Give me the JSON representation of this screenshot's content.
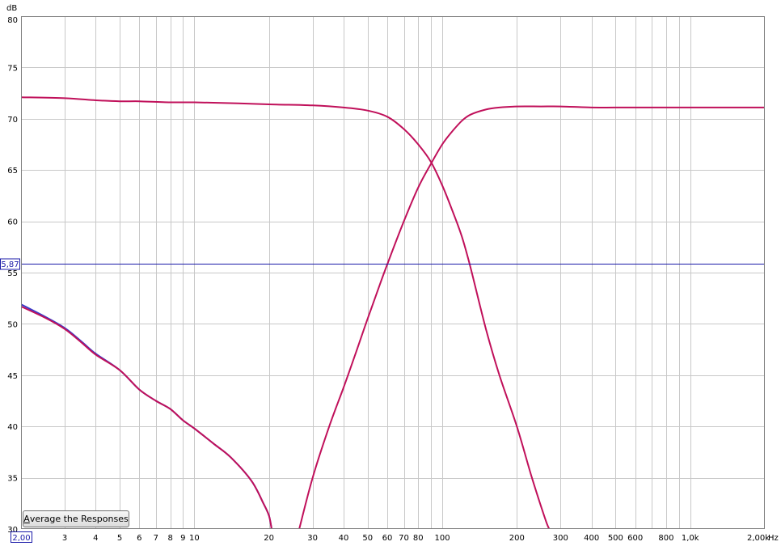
{
  "chart_data": {
    "type": "line",
    "title": "",
    "xlabel": "Hz",
    "ylabel": "dB",
    "xscale": "log",
    "xlim": [
      2,
      2000
    ],
    "ylim": [
      30,
      80
    ],
    "grid": true,
    "x_tick_labels": [
      "2,00",
      "3",
      "4",
      "5",
      "6",
      "7",
      "8",
      "9",
      "10",
      "20",
      "30",
      "40",
      "50",
      "60",
      "70",
      "80",
      "100",
      "200",
      "300",
      "400",
      "500",
      "600",
      "800",
      "1,0k",
      "2,00k"
    ],
    "x_tick_values": [
      2,
      3,
      4,
      5,
      6,
      7,
      8,
      9,
      10,
      20,
      30,
      40,
      50,
      60,
      70,
      80,
      100,
      200,
      300,
      400,
      500,
      600,
      800,
      1000,
      2000
    ],
    "x_unit": "Hz",
    "x_start_label": "2,00",
    "y_tick_labels": [
      "80",
      "75",
      "70",
      "65",
      "60",
      "55",
      "50",
      "45",
      "40",
      "35",
      "30"
    ],
    "y_tick_values": [
      80,
      75,
      70,
      65,
      60,
      55,
      50,
      45,
      40,
      35,
      30
    ],
    "y_unit": "dB",
    "cursor": {
      "value": 55.87,
      "label": "5,87",
      "color": "#1a1aa8"
    },
    "series": [
      {
        "color": "#c0105a",
        "x": [
          2,
          3,
          4,
          5,
          6,
          8,
          10,
          15,
          20,
          30,
          40,
          50,
          60,
          70,
          80,
          90,
          100,
          110,
          120,
          130,
          150,
          170,
          200,
          230,
          260,
          270
        ],
        "y": [
          72.1,
          72.0,
          71.8,
          71.7,
          71.7,
          71.6,
          71.6,
          71.5,
          71.4,
          71.3,
          71.1,
          70.8,
          70.2,
          69.0,
          67.5,
          65.8,
          63.5,
          61.0,
          58.5,
          55.5,
          49.5,
          45.0,
          40.0,
          35.0,
          31.0,
          30.0
        ]
      },
      {
        "color": "#c0105a",
        "x": [
          26.5,
          30,
          35,
          40,
          45,
          50,
          55,
          60,
          70,
          80,
          90,
          100,
          110,
          120,
          130,
          150,
          170,
          200,
          250,
          300,
          400,
          500,
          700,
          1000,
          1500,
          2000
        ],
        "y": [
          30.0,
          35.0,
          40.0,
          43.8,
          47.3,
          50.5,
          53.3,
          55.8,
          60.0,
          63.3,
          65.6,
          67.5,
          68.8,
          69.8,
          70.4,
          70.9,
          71.1,
          71.2,
          71.2,
          71.2,
          71.1,
          71.1,
          71.1,
          71.1,
          71.1,
          71.1
        ]
      },
      {
        "color": "#c0105a",
        "x": [
          2,
          2.5,
          3,
          3.5,
          4,
          5,
          6,
          7,
          8,
          9,
          10,
          12,
          14,
          17,
          19,
          20,
          20.5
        ],
        "y": [
          51.7,
          50.6,
          49.5,
          48.2,
          47.0,
          45.5,
          43.6,
          42.5,
          41.7,
          40.6,
          39.8,
          38.3,
          37.0,
          34.7,
          32.5,
          31.3,
          30.0
        ]
      },
      {
        "color": "#3a3ac8",
        "x": [
          2,
          2.5,
          3,
          3.5,
          4,
          5,
          6,
          7,
          8,
          9,
          10,
          12,
          14,
          17,
          19,
          20,
          20.5
        ],
        "y": [
          51.9,
          50.7,
          49.6,
          48.3,
          47.1,
          45.5,
          43.6,
          42.5,
          41.7,
          40.6,
          39.8,
          38.3,
          37.0,
          34.7,
          32.5,
          31.3,
          30.0
        ]
      }
    ]
  },
  "button": {
    "label_first": "A",
    "label_rest": "verage the Responses"
  }
}
